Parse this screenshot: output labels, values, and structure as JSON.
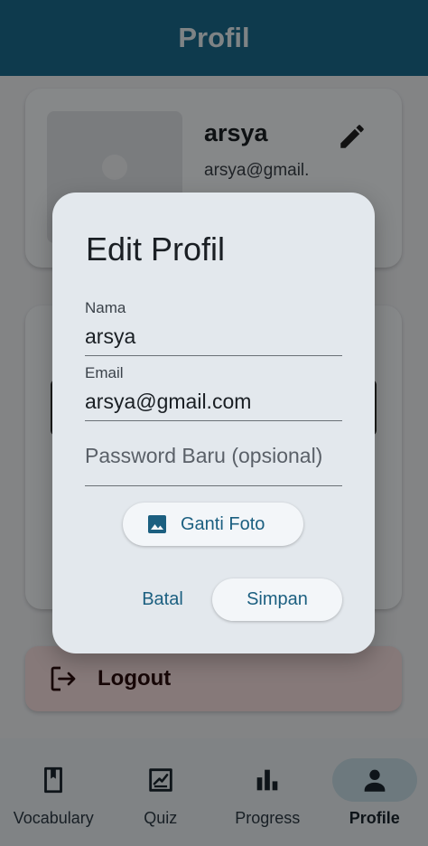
{
  "app_bar": {
    "title": "Profil"
  },
  "profile": {
    "name": "arsya",
    "email": "arsya@gmail."
  },
  "logout": {
    "label": "Logout"
  },
  "bottom_nav": {
    "items": [
      {
        "label": "Vocabulary",
        "icon": "book-icon",
        "active": false
      },
      {
        "label": "Quiz",
        "icon": "quiz-icon",
        "active": false
      },
      {
        "label": "Progress",
        "icon": "bar-chart-icon",
        "active": false
      },
      {
        "label": "Profile",
        "icon": "person-icon",
        "active": true
      }
    ]
  },
  "dialog": {
    "title": "Edit Profil",
    "name_field": {
      "label": "Nama",
      "value": "arsya"
    },
    "email_field": {
      "label": "Email",
      "value": "arsya@gmail.com"
    },
    "password_field": {
      "placeholder": "Password Baru (opsional)"
    },
    "change_photo_label": "Ganti Foto",
    "cancel_label": "Batal",
    "save_label": "Simpan"
  },
  "colors": {
    "primary": "#1b6b8c",
    "accent_text": "#1b5f80",
    "dialog_bg": "#e3e8ed",
    "logout_bg": "#f5dcdc"
  }
}
